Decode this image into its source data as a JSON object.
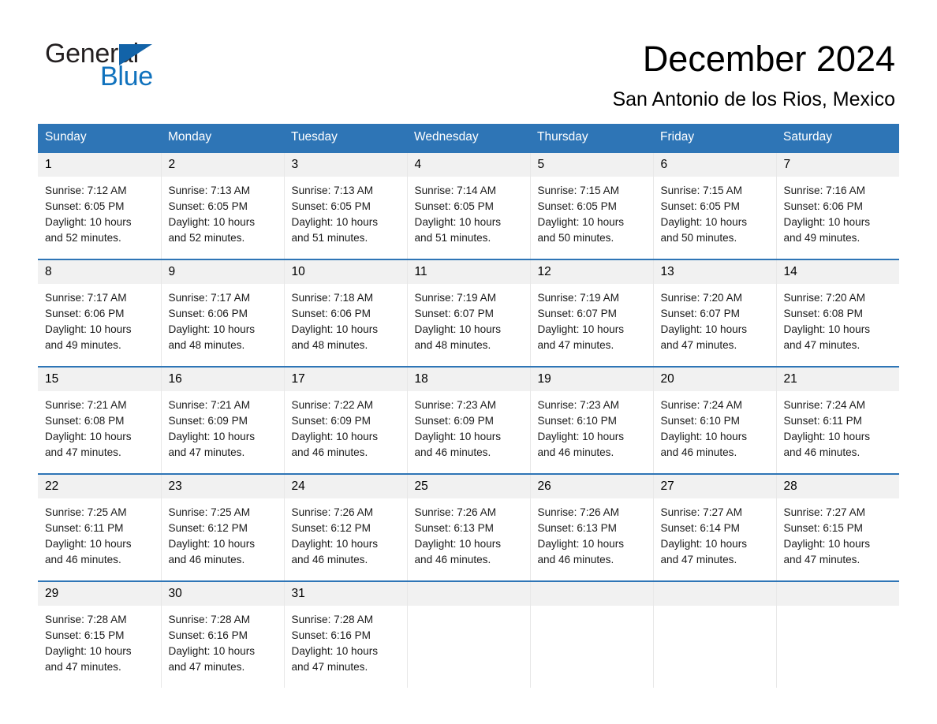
{
  "brand": {
    "name_part1": "General",
    "name_part2": "Blue",
    "triangle_color": "#1263a8",
    "blue_text_color": "#1072bd"
  },
  "header": {
    "title": "December 2024",
    "subtitle": "San Antonio de los Rios, Mexico",
    "accent_color": "#2e75b6",
    "daynum_band_color": "#f1f1f1"
  },
  "weekday_headers": [
    "Sunday",
    "Monday",
    "Tuesday",
    "Wednesday",
    "Thursday",
    "Friday",
    "Saturday"
  ],
  "weeks": [
    [
      {
        "day": "1",
        "sunrise": "Sunrise: 7:12 AM",
        "sunset": "Sunset: 6:05 PM",
        "daylight_line1": "Daylight: 10 hours",
        "daylight_line2": "and 52 minutes."
      },
      {
        "day": "2",
        "sunrise": "Sunrise: 7:13 AM",
        "sunset": "Sunset: 6:05 PM",
        "daylight_line1": "Daylight: 10 hours",
        "daylight_line2": "and 52 minutes."
      },
      {
        "day": "3",
        "sunrise": "Sunrise: 7:13 AM",
        "sunset": "Sunset: 6:05 PM",
        "daylight_line1": "Daylight: 10 hours",
        "daylight_line2": "and 51 minutes."
      },
      {
        "day": "4",
        "sunrise": "Sunrise: 7:14 AM",
        "sunset": "Sunset: 6:05 PM",
        "daylight_line1": "Daylight: 10 hours",
        "daylight_line2": "and 51 minutes."
      },
      {
        "day": "5",
        "sunrise": "Sunrise: 7:15 AM",
        "sunset": "Sunset: 6:05 PM",
        "daylight_line1": "Daylight: 10 hours",
        "daylight_line2": "and 50 minutes."
      },
      {
        "day": "6",
        "sunrise": "Sunrise: 7:15 AM",
        "sunset": "Sunset: 6:05 PM",
        "daylight_line1": "Daylight: 10 hours",
        "daylight_line2": "and 50 minutes."
      },
      {
        "day": "7",
        "sunrise": "Sunrise: 7:16 AM",
        "sunset": "Sunset: 6:06 PM",
        "daylight_line1": "Daylight: 10 hours",
        "daylight_line2": "and 49 minutes."
      }
    ],
    [
      {
        "day": "8",
        "sunrise": "Sunrise: 7:17 AM",
        "sunset": "Sunset: 6:06 PM",
        "daylight_line1": "Daylight: 10 hours",
        "daylight_line2": "and 49 minutes."
      },
      {
        "day": "9",
        "sunrise": "Sunrise: 7:17 AM",
        "sunset": "Sunset: 6:06 PM",
        "daylight_line1": "Daylight: 10 hours",
        "daylight_line2": "and 48 minutes."
      },
      {
        "day": "10",
        "sunrise": "Sunrise: 7:18 AM",
        "sunset": "Sunset: 6:06 PM",
        "daylight_line1": "Daylight: 10 hours",
        "daylight_line2": "and 48 minutes."
      },
      {
        "day": "11",
        "sunrise": "Sunrise: 7:19 AM",
        "sunset": "Sunset: 6:07 PM",
        "daylight_line1": "Daylight: 10 hours",
        "daylight_line2": "and 48 minutes."
      },
      {
        "day": "12",
        "sunrise": "Sunrise: 7:19 AM",
        "sunset": "Sunset: 6:07 PM",
        "daylight_line1": "Daylight: 10 hours",
        "daylight_line2": "and 47 minutes."
      },
      {
        "day": "13",
        "sunrise": "Sunrise: 7:20 AM",
        "sunset": "Sunset: 6:07 PM",
        "daylight_line1": "Daylight: 10 hours",
        "daylight_line2": "and 47 minutes."
      },
      {
        "day": "14",
        "sunrise": "Sunrise: 7:20 AM",
        "sunset": "Sunset: 6:08 PM",
        "daylight_line1": "Daylight: 10 hours",
        "daylight_line2": "and 47 minutes."
      }
    ],
    [
      {
        "day": "15",
        "sunrise": "Sunrise: 7:21 AM",
        "sunset": "Sunset: 6:08 PM",
        "daylight_line1": "Daylight: 10 hours",
        "daylight_line2": "and 47 minutes."
      },
      {
        "day": "16",
        "sunrise": "Sunrise: 7:21 AM",
        "sunset": "Sunset: 6:09 PM",
        "daylight_line1": "Daylight: 10 hours",
        "daylight_line2": "and 47 minutes."
      },
      {
        "day": "17",
        "sunrise": "Sunrise: 7:22 AM",
        "sunset": "Sunset: 6:09 PM",
        "daylight_line1": "Daylight: 10 hours",
        "daylight_line2": "and 46 minutes."
      },
      {
        "day": "18",
        "sunrise": "Sunrise: 7:23 AM",
        "sunset": "Sunset: 6:09 PM",
        "daylight_line1": "Daylight: 10 hours",
        "daylight_line2": "and 46 minutes."
      },
      {
        "day": "19",
        "sunrise": "Sunrise: 7:23 AM",
        "sunset": "Sunset: 6:10 PM",
        "daylight_line1": "Daylight: 10 hours",
        "daylight_line2": "and 46 minutes."
      },
      {
        "day": "20",
        "sunrise": "Sunrise: 7:24 AM",
        "sunset": "Sunset: 6:10 PM",
        "daylight_line1": "Daylight: 10 hours",
        "daylight_line2": "and 46 minutes."
      },
      {
        "day": "21",
        "sunrise": "Sunrise: 7:24 AM",
        "sunset": "Sunset: 6:11 PM",
        "daylight_line1": "Daylight: 10 hours",
        "daylight_line2": "and 46 minutes."
      }
    ],
    [
      {
        "day": "22",
        "sunrise": "Sunrise: 7:25 AM",
        "sunset": "Sunset: 6:11 PM",
        "daylight_line1": "Daylight: 10 hours",
        "daylight_line2": "and 46 minutes."
      },
      {
        "day": "23",
        "sunrise": "Sunrise: 7:25 AM",
        "sunset": "Sunset: 6:12 PM",
        "daylight_line1": "Daylight: 10 hours",
        "daylight_line2": "and 46 minutes."
      },
      {
        "day": "24",
        "sunrise": "Sunrise: 7:26 AM",
        "sunset": "Sunset: 6:12 PM",
        "daylight_line1": "Daylight: 10 hours",
        "daylight_line2": "and 46 minutes."
      },
      {
        "day": "25",
        "sunrise": "Sunrise: 7:26 AM",
        "sunset": "Sunset: 6:13 PM",
        "daylight_line1": "Daylight: 10 hours",
        "daylight_line2": "and 46 minutes."
      },
      {
        "day": "26",
        "sunrise": "Sunrise: 7:26 AM",
        "sunset": "Sunset: 6:13 PM",
        "daylight_line1": "Daylight: 10 hours",
        "daylight_line2": "and 46 minutes."
      },
      {
        "day": "27",
        "sunrise": "Sunrise: 7:27 AM",
        "sunset": "Sunset: 6:14 PM",
        "daylight_line1": "Daylight: 10 hours",
        "daylight_line2": "and 47 minutes."
      },
      {
        "day": "28",
        "sunrise": "Sunrise: 7:27 AM",
        "sunset": "Sunset: 6:15 PM",
        "daylight_line1": "Daylight: 10 hours",
        "daylight_line2": "and 47 minutes."
      }
    ],
    [
      {
        "day": "29",
        "sunrise": "Sunrise: 7:28 AM",
        "sunset": "Sunset: 6:15 PM",
        "daylight_line1": "Daylight: 10 hours",
        "daylight_line2": "and 47 minutes."
      },
      {
        "day": "30",
        "sunrise": "Sunrise: 7:28 AM",
        "sunset": "Sunset: 6:16 PM",
        "daylight_line1": "Daylight: 10 hours",
        "daylight_line2": "and 47 minutes."
      },
      {
        "day": "31",
        "sunrise": "Sunrise: 7:28 AM",
        "sunset": "Sunset: 6:16 PM",
        "daylight_line1": "Daylight: 10 hours",
        "daylight_line2": "and 47 minutes."
      },
      {
        "day": "",
        "sunrise": "",
        "sunset": "",
        "daylight_line1": "",
        "daylight_line2": ""
      },
      {
        "day": "",
        "sunrise": "",
        "sunset": "",
        "daylight_line1": "",
        "daylight_line2": ""
      },
      {
        "day": "",
        "sunrise": "",
        "sunset": "",
        "daylight_line1": "",
        "daylight_line2": ""
      },
      {
        "day": "",
        "sunrise": "",
        "sunset": "",
        "daylight_line1": "",
        "daylight_line2": ""
      }
    ]
  ]
}
